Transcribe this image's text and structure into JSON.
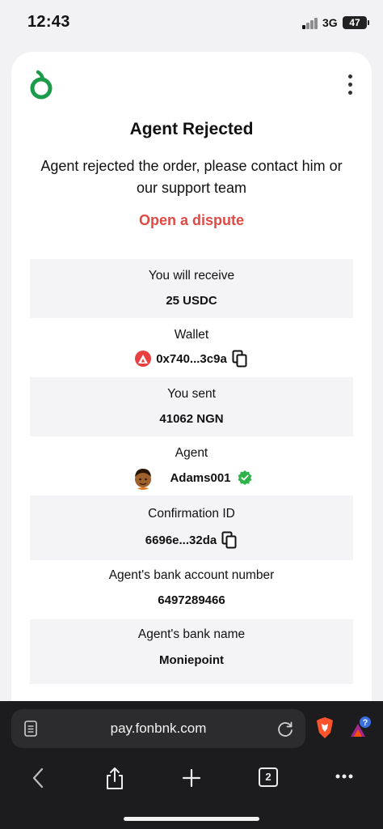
{
  "status_bar": {
    "time": "12:43",
    "network": "3G",
    "battery": "47"
  },
  "page": {
    "title": "Agent Rejected",
    "message": "Agent rejected the order, please contact him or our support team",
    "dispute_link": "Open a dispute"
  },
  "details": {
    "receive_label": "You will receive",
    "receive_value": "25 USDC",
    "wallet_label": "Wallet",
    "wallet_value": "0x740...3c9a",
    "sent_label": "You sent",
    "sent_value": "41062 NGN",
    "agent_label": "Agent",
    "agent_value": "Adams001",
    "confirmation_label": "Confirmation ID",
    "confirmation_value": "6696e...32da",
    "bank_account_label": "Agent's bank account number",
    "bank_account_value": "6497289466",
    "bank_name_label": "Agent's bank name",
    "bank_name_value": "Moniepoint"
  },
  "browser": {
    "url": "pay.fonbnk.com",
    "tab_count": "2",
    "rewards_badge": "?"
  },
  "colors": {
    "brand_green": "#1a9c4b",
    "dispute_red": "#e04a45",
    "avalanche_red": "#e84142",
    "verified_green": "#2db34a"
  }
}
